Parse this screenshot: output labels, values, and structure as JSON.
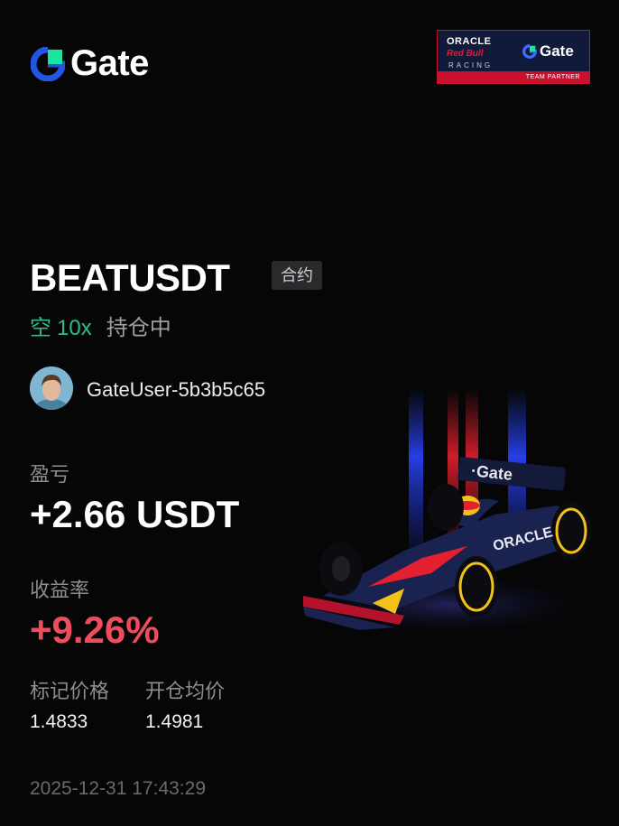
{
  "brand": {
    "name": "Gate",
    "accent": "#2354e6",
    "accent2": "#17e5a0"
  },
  "partner": {
    "oracle": "ORACLE",
    "redbull": "Red Bull",
    "racing": "RACING",
    "gate": "Gate",
    "tagline": "TEAM PARTNER"
  },
  "position": {
    "pair": "BEATUSDT",
    "type_badge": "合约",
    "direction": "空",
    "leverage": "10x",
    "status": "持仓中"
  },
  "user": {
    "name": "GateUser-5b3b5c65"
  },
  "pnl": {
    "label": "盈亏",
    "value": "+2.66 USDT"
  },
  "roi": {
    "label": "收益率",
    "value": "+9.26%"
  },
  "prices": {
    "mark_label": "标记价格",
    "mark_value": "1.4833",
    "entry_label": "开仓均价",
    "entry_value": "1.4981"
  },
  "timestamp": "2025-12-31 17:43:29",
  "colors": {
    "long_short_green": "#2fbd85",
    "profit_red": "#ef4d5e",
    "background": "#060606"
  }
}
